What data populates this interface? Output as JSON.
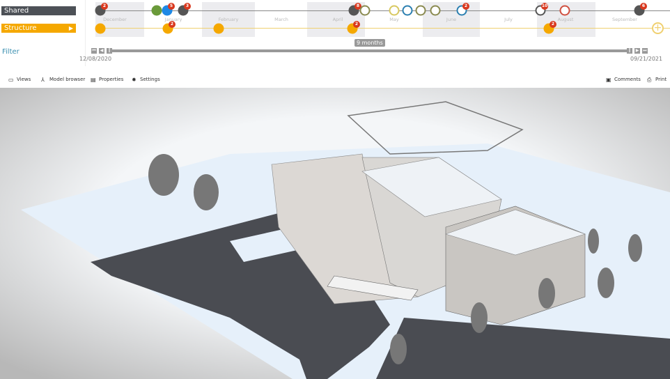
{
  "timeline": {
    "lanes": [
      {
        "label": "Shared",
        "color": "#4d5157"
      },
      {
        "label": "Structure",
        "color": "#f5a800",
        "arrow": "▶"
      }
    ],
    "filter_label": "Filter",
    "months": [
      "December",
      "January",
      "February",
      "March",
      "April",
      "May",
      "June",
      "July",
      "August",
      "September"
    ],
    "shared_nodes": [
      {
        "fill": "#555",
        "badge": "2"
      },
      {
        "fill": "#6a9a3a"
      },
      {
        "fill": "#1e88e5",
        "badge": "5"
      },
      {
        "fill": "#555",
        "badge": "3"
      },
      {
        "fill": "#555",
        "badge": "8"
      },
      {
        "stroke": "#8a8a50"
      },
      {
        "stroke": "#d8c860"
      },
      {
        "stroke": "#2b7fb0"
      },
      {
        "stroke": "#8a8a50"
      },
      {
        "stroke": "#8a8a50"
      },
      {
        "stroke": "#2b7fb0",
        "badge": "2"
      },
      {
        "stroke": "#555",
        "badge": "10"
      },
      {
        "stroke": "#d05040"
      },
      {
        "fill": "#555",
        "badge": "6"
      }
    ],
    "structure_nodes": [
      {
        "badge": ""
      },
      {
        "badge": "2"
      },
      {
        "badge": ""
      },
      {
        "badge": "2"
      },
      {
        "badge": "2"
      }
    ],
    "add_icon": "plus-circle-icon",
    "range_label": "9 months",
    "start_date": "12/08/2020",
    "end_date": "09/21/2021"
  },
  "toolbar": {
    "left": [
      {
        "label": "Views",
        "icon": "monitor-icon"
      },
      {
        "label": "Model browser",
        "icon": "hierarchy-icon"
      },
      {
        "label": "Properties",
        "icon": "document-icon"
      },
      {
        "label": "Settings",
        "icon": "gear-icon"
      }
    ],
    "right": [
      {
        "label": "Comments",
        "icon": "comment-icon"
      },
      {
        "label": "Print",
        "icon": "printer-icon"
      }
    ]
  },
  "colors": {
    "shared": "#4d5157",
    "structure": "#f5a800",
    "badge": "#d9381e",
    "ground": "#e6f0fa"
  }
}
